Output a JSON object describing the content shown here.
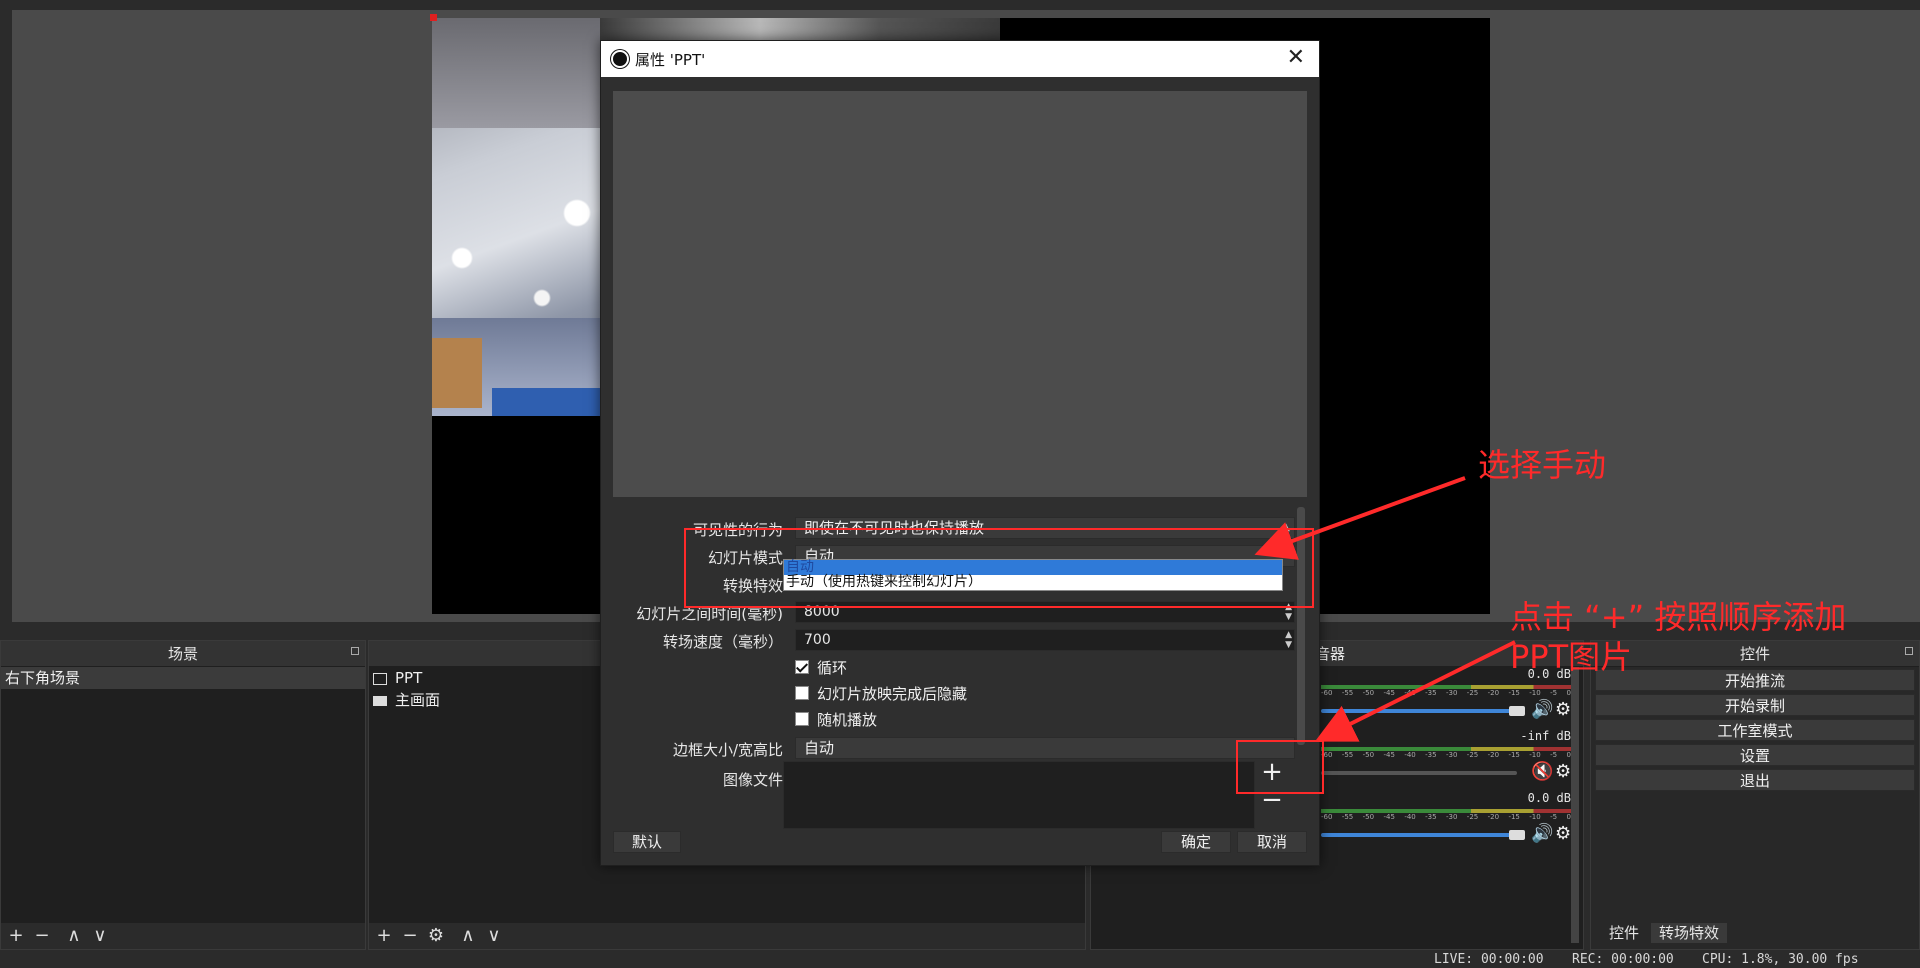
{
  "canvas": {
    "name": "preview-canvas"
  },
  "docks": {
    "scenes": {
      "title": "场景",
      "items": [
        "右下角场景"
      ]
    },
    "sources": {
      "items": [
        {
          "label": "PPT"
        },
        {
          "label": "主画面"
        }
      ]
    },
    "mixer": {
      "title": "音器",
      "channels": [
        {
          "db": "0.0 dB"
        },
        {
          "db": "-inf dB"
        },
        {
          "db": "0.0 dB"
        }
      ],
      "tick_labels": [
        "-60",
        "-55",
        "-50",
        "-45",
        "-40",
        "-35",
        "-30",
        "-25",
        "-20",
        "-15",
        "-10",
        "-5",
        "0"
      ]
    },
    "controls": {
      "title": "控件",
      "buttons": [
        "开始推流",
        "开始录制",
        "工作室模式",
        "设置",
        "退出"
      ],
      "tabs": [
        "控件",
        "转场特效"
      ]
    }
  },
  "toolbar_glyphs": {
    "add": "+",
    "remove": "−",
    "up": "∧",
    "down": "∨",
    "gear": "⚙"
  },
  "status": {
    "live": "LIVE: 00:00:00",
    "rec": "REC: 00:00:00",
    "cpu": "CPU: 1.8%, 30.00 fps"
  },
  "dialog": {
    "title": "属性 'PPT'",
    "props": {
      "visibility_label": "可见性的行为",
      "visibility_value": "即使在不可见时也保持播放",
      "slide_mode_label": "幻灯片模式",
      "slide_mode_value": "自动",
      "slide_mode_options": [
        "自动",
        "手动（使用热键来控制幻灯片）"
      ],
      "transition_label": "转换特效",
      "interval_label": "幻灯片之间时间(毫秒)",
      "interval_value": "8000",
      "speed_label": "转场速度（毫秒）",
      "speed_value": "700",
      "loop_label": "循环",
      "loop_checked": true,
      "hide_label": "幻灯片放映完成后隐藏",
      "hide_checked": false,
      "random_label": "随机播放",
      "random_checked": false,
      "bounds_label": "边框大小/宽高比",
      "bounds_value": "自动",
      "files_label": "图像文件"
    },
    "buttons": {
      "defaults": "默认",
      "ok": "确定",
      "cancel": "取消"
    }
  },
  "annotations": {
    "choose_manual": "选择手动",
    "click_plus_line1": "点击 “+” 按照顺序添加",
    "click_plus_line2": "PPT图片",
    "color": "#ff2a2a"
  }
}
